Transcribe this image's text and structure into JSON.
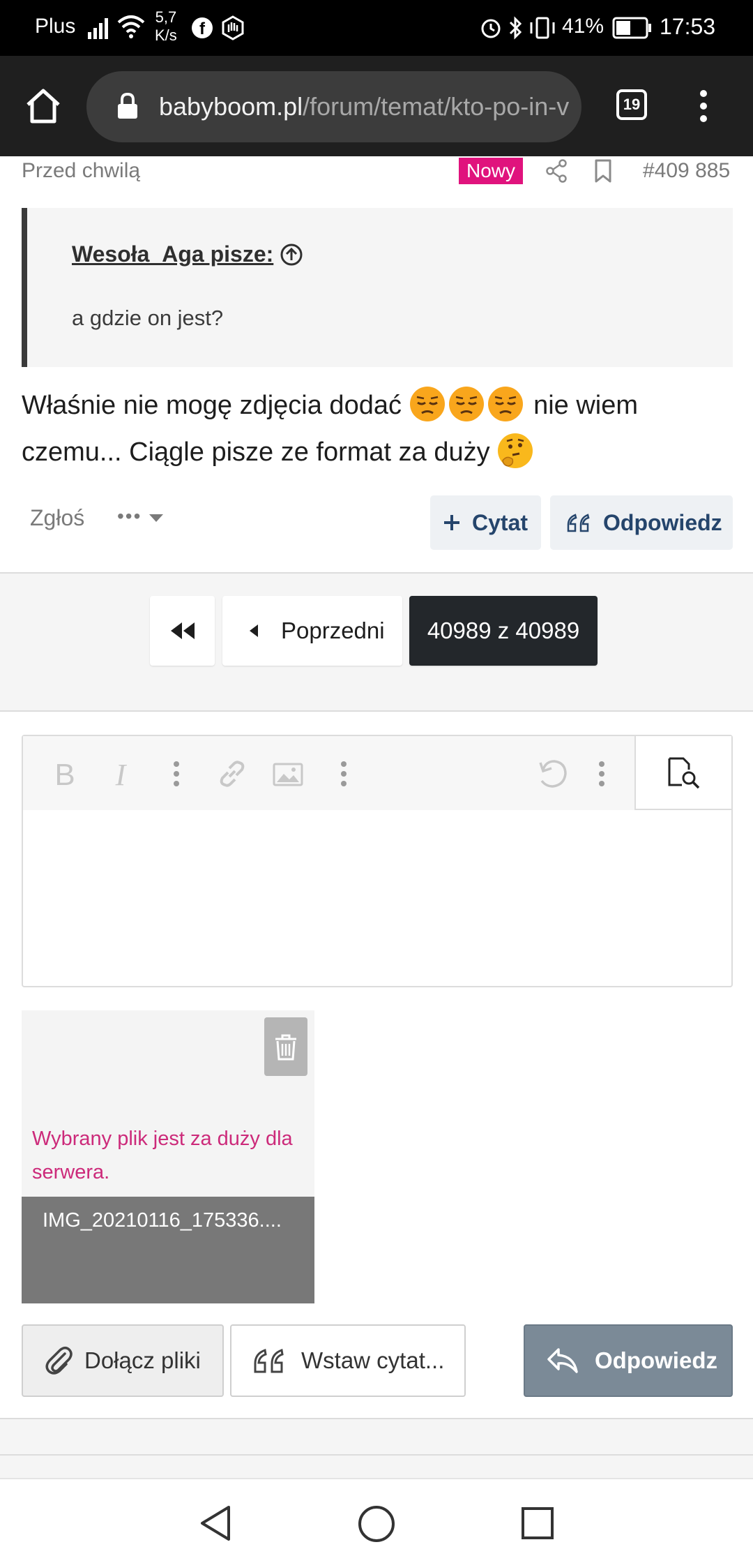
{
  "status_bar": {
    "carrier": "Plus",
    "net_speed_value": "5,7",
    "net_speed_unit": "K/s",
    "battery": "41%",
    "time": "17:53"
  },
  "browser": {
    "url_host": "babyboom.pl",
    "url_path": "/forum/temat/kto-po-in-v",
    "tab_count": "19"
  },
  "post": {
    "time_ago": "Przed chwilą",
    "badge": "Nowy",
    "post_number": "#409 885",
    "quote_author": "Wesoła_Aga pisze:",
    "quote_text": "a gdzie on jest?",
    "body_part1": "Właśnie nie mogę zdjęcia dodać ",
    "body_part2": " nie wiem czemu... Ciągle pisze ze format za duży ",
    "report_label": "Zgłoś",
    "more_label": "•••",
    "cite_label": "Cytat",
    "reply_label": "Odpowiedz"
  },
  "pagination": {
    "prev_label": "Poprzedni",
    "current": "40989 z 40989"
  },
  "attachment": {
    "error": "Wybrany plik jest za duży dla serwera.",
    "filename": "IMG_20210116_175336...."
  },
  "actions": {
    "attach_files": "Dołącz pliki",
    "insert_quote": "Wstaw cytat...",
    "reply": "Odpowiedz"
  },
  "colors": {
    "badge": "#e0137d",
    "error_text": "#cc2a7a",
    "reply_button": "#7b8a97",
    "link_blue": "#25456c"
  }
}
